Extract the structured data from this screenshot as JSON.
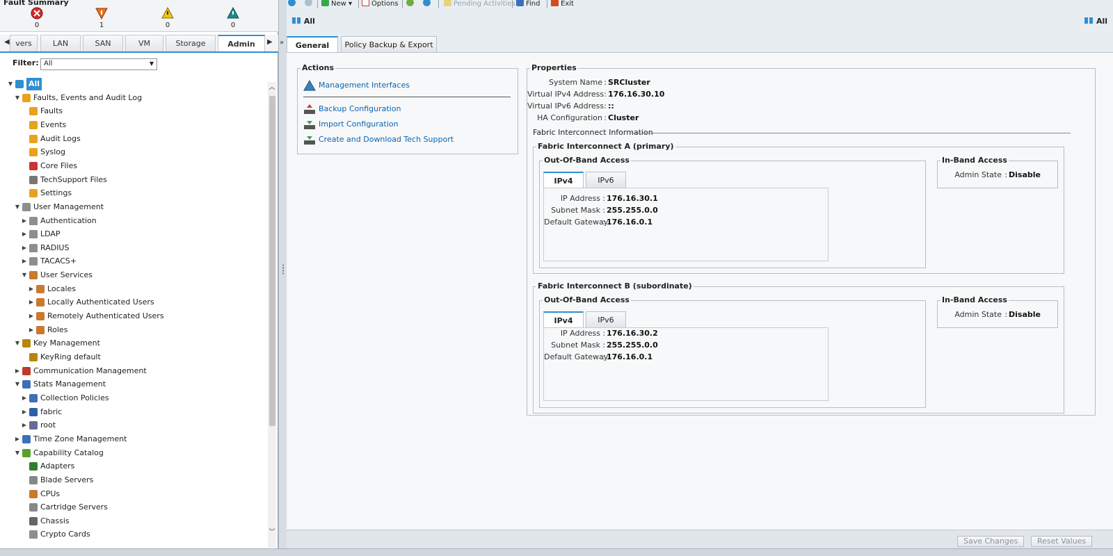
{
  "fault_summary": {
    "title": "Fault Summary",
    "critical": "0",
    "major": "1",
    "minor": "0",
    "warning": "0"
  },
  "nav_tabs": [
    "vers",
    "LAN",
    "SAN",
    "VM",
    "Storage",
    "Admin"
  ],
  "filter": {
    "label": "Filter:",
    "value": "All"
  },
  "tree": [
    {
      "label": "All",
      "icon": "all-icon"
    },
    {
      "label": "Faults, Events and Audit Log",
      "icon": "fault-icon"
    },
    {
      "label": "Faults",
      "icon": "fault-icon"
    },
    {
      "label": "Events",
      "icon": "fault-icon"
    },
    {
      "label": "Audit Logs",
      "icon": "fault-icon"
    },
    {
      "label": "Syslog",
      "icon": "fault-icon"
    },
    {
      "label": "Core Files",
      "icon": "core-file-icon"
    },
    {
      "label": "TechSupport Files",
      "icon": "file-icon"
    },
    {
      "label": "Settings",
      "icon": "fault-icon"
    },
    {
      "label": "User Management",
      "icon": "lock-icon"
    },
    {
      "label": "Authentication",
      "icon": "lock-icon"
    },
    {
      "label": "LDAP",
      "icon": "lock-icon"
    },
    {
      "label": "RADIUS",
      "icon": "lock-icon"
    },
    {
      "label": "TACACS+",
      "icon": "lock-icon"
    },
    {
      "label": "User Services",
      "icon": "users-icon"
    },
    {
      "label": "Locales",
      "icon": "users-icon"
    },
    {
      "label": "Locally Authenticated Users",
      "icon": "users-icon"
    },
    {
      "label": "Remotely Authenticated Users",
      "icon": "users-icon"
    },
    {
      "label": "Roles",
      "icon": "users-icon"
    },
    {
      "label": "Key Management",
      "icon": "key-icon"
    },
    {
      "label": "KeyRing default",
      "icon": "key-icon"
    },
    {
      "label": "Communication Management",
      "icon": "communication-icon"
    },
    {
      "label": "Stats Management",
      "icon": "stats-icon"
    },
    {
      "label": "Collection Policies",
      "icon": "stats-icon"
    },
    {
      "label": "fabric",
      "icon": "fabric-icon"
    },
    {
      "label": "root",
      "icon": "root-icon"
    },
    {
      "label": "Time Zone Management",
      "icon": "clock-icon"
    },
    {
      "label": "Capability Catalog",
      "icon": "catalog-icon"
    },
    {
      "label": "Adapters",
      "icon": "adapter-icon"
    },
    {
      "label": "Blade Servers",
      "icon": "server-icon"
    },
    {
      "label": "CPUs",
      "icon": "cpu-icon"
    },
    {
      "label": "Cartridge Servers",
      "icon": "server-icon"
    },
    {
      "label": "Chassis",
      "icon": "chassis-icon"
    },
    {
      "label": "Crypto Cards",
      "icon": "lock-icon"
    }
  ],
  "toolbar": {
    "new": "New",
    "options": "Options",
    "pending": "Pending Activities",
    "find": "Find",
    "exit": "Exit"
  },
  "breadcrumb": "All",
  "breadcrumb_right": "All",
  "content_tabs": [
    "General",
    "Policy Backup & Export"
  ],
  "actions": {
    "legend": "Actions",
    "items": [
      "Management Interfaces",
      "Backup Configuration",
      "Import Configuration",
      "Create and Download Tech Support"
    ]
  },
  "properties": {
    "legend": "Properties",
    "system_name_label": "System Name",
    "system_name": "SRCluster",
    "vipv4_label": "Virtual IPv4 Address",
    "vipv4": "176.16.30.10",
    "vipv6_label": "Virtual IPv6 Address",
    "vipv6": "::",
    "ha_label": "HA Configuration",
    "ha": "Cluster",
    "fi_info": "Fabric Interconnect Information"
  },
  "fi_a": {
    "legend": "Fabric Interconnect A (primary)",
    "oob_legend": "Out-Of-Band Access",
    "tabs": [
      "IPv4",
      "IPv6"
    ],
    "ip_label": "IP Address",
    "ip": "176.16.30.1",
    "mask_label": "Subnet Mask",
    "mask": "255.255.0.0",
    "gw_label": "Default Gateway",
    "gw": "176.16.0.1",
    "inband_legend": "In-Band Access",
    "admin_label": "Admin State",
    "admin": "Disable"
  },
  "fi_b": {
    "legend": "Fabric Interconnect B (subordinate)",
    "oob_legend": "Out-Of-Band Access",
    "tabs": [
      "IPv4",
      "IPv6"
    ],
    "ip_label": "IP Address",
    "ip": "176.16.30.2",
    "mask_label": "Subnet Mask",
    "mask": "255.255.0.0",
    "gw_label": "Default Gateway",
    "gw": "176.16.0.1",
    "inband_legend": "In-Band Access",
    "admin_label": "Admin State",
    "admin": "Disable"
  },
  "footer": {
    "save": "Save Changes",
    "reset": "Reset Values"
  }
}
